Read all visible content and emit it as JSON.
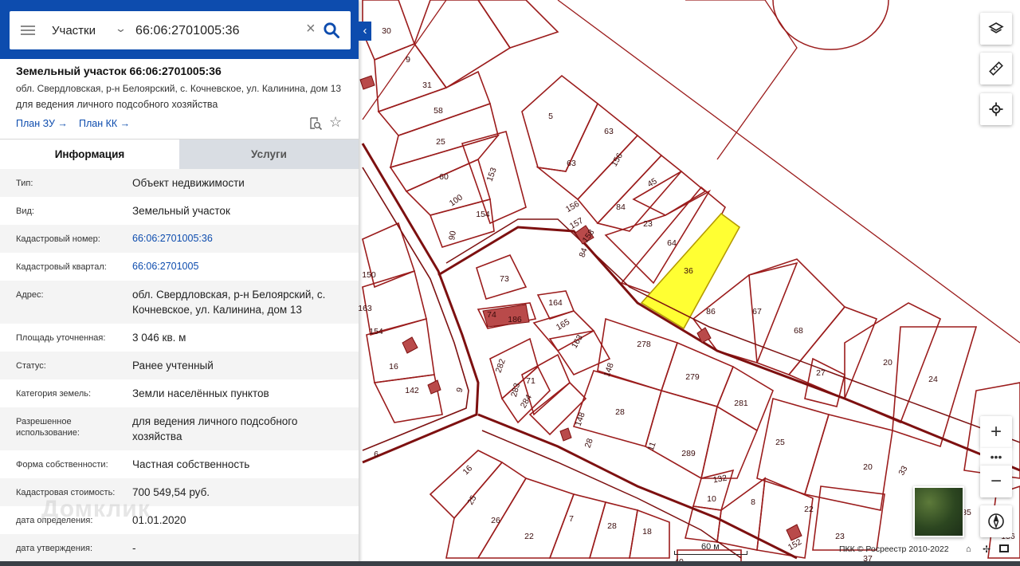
{
  "search": {
    "scope": "Участки",
    "value": "66:06:2701005:36"
  },
  "object": {
    "title": "Земельный участок 66:06:2701005:36",
    "address": "обл. Свердловская, р-н Белоярский, с. Кочневское, ул. Калинина, дом 13",
    "purpose": "для ведения личного подсобного хозяйства",
    "links": [
      "План ЗУ →",
      "План КК →"
    ]
  },
  "tabs": [
    "Информация",
    "Услуги"
  ],
  "info_rows": [
    {
      "label": "Тип:",
      "value": "Объект недвижимости"
    },
    {
      "label": "Вид:",
      "value": "Земельный участок"
    },
    {
      "label": "Кадастровый номер:",
      "value": "66:06:2701005:36"
    },
    {
      "label": "Кадастровый квартал:",
      "value": "66:06:2701005"
    },
    {
      "label": "Адрес:",
      "value": "обл. Свердловская, р-н Белоярский, с. Кочневское, ул. Калинина, дом 13"
    },
    {
      "label": "Площадь уточненная:",
      "value": "3 046 кв. м"
    },
    {
      "label": "Статус:",
      "value": "Ранее учтенный"
    },
    {
      "label": "Категория земель:",
      "value": "Земли населённых пунктов"
    },
    {
      "label": "Разрешенное использование:",
      "value": "для ведения личного подсобного хозяйства"
    },
    {
      "label": "Форма собственности:",
      "value": "Частная собственность"
    },
    {
      "label": "Кадастровая стоимость:",
      "value": "700 549,54 руб."
    },
    {
      "label": "дата определения:",
      "value": "01.01.2020"
    },
    {
      "label": "дата утверждения:",
      "value": "-"
    }
  ],
  "watermark": "Домклик",
  "map": {
    "scale_label": "60 м",
    "copyright": "ПКК © Росреестр 2010-2022",
    "selected_parcel": "36",
    "parcel_labels": [
      "30",
      "9",
      "31",
      "58",
      "25",
      "60",
      "100",
      "153",
      "154",
      "90",
      "150",
      "163",
      "154",
      "16",
      "142",
      "6",
      "9",
      "5",
      "63",
      "63",
      "156",
      "45",
      "84",
      "23",
      "64",
      "156",
      "157",
      "158",
      "84",
      "36",
      "86",
      "67",
      "68",
      "27",
      "20",
      "24",
      "73",
      "74",
      "186",
      "164",
      "165",
      "163",
      "282",
      "283",
      "71",
      "284",
      "278",
      "148",
      "148",
      "28",
      "279",
      "281",
      "25",
      "28",
      "11",
      "289",
      "132",
      "10",
      "8",
      "22",
      "20",
      "33",
      "35",
      "16",
      "25",
      "26",
      "22",
      "7",
      "28",
      "18",
      "152",
      "23",
      "37",
      "156",
      "40"
    ],
    "colors": {
      "parcel_outline": "#9b1c1c",
      "selected_fill": "#ffff33",
      "building_fill": "#b94a4a",
      "road_line": "#7d1010",
      "panel_header": "#0d4cae",
      "link_color": "#0d4cae"
    }
  },
  "controls": {
    "zoom_in": "+",
    "zoom_more": "•••",
    "zoom_out": "−"
  }
}
